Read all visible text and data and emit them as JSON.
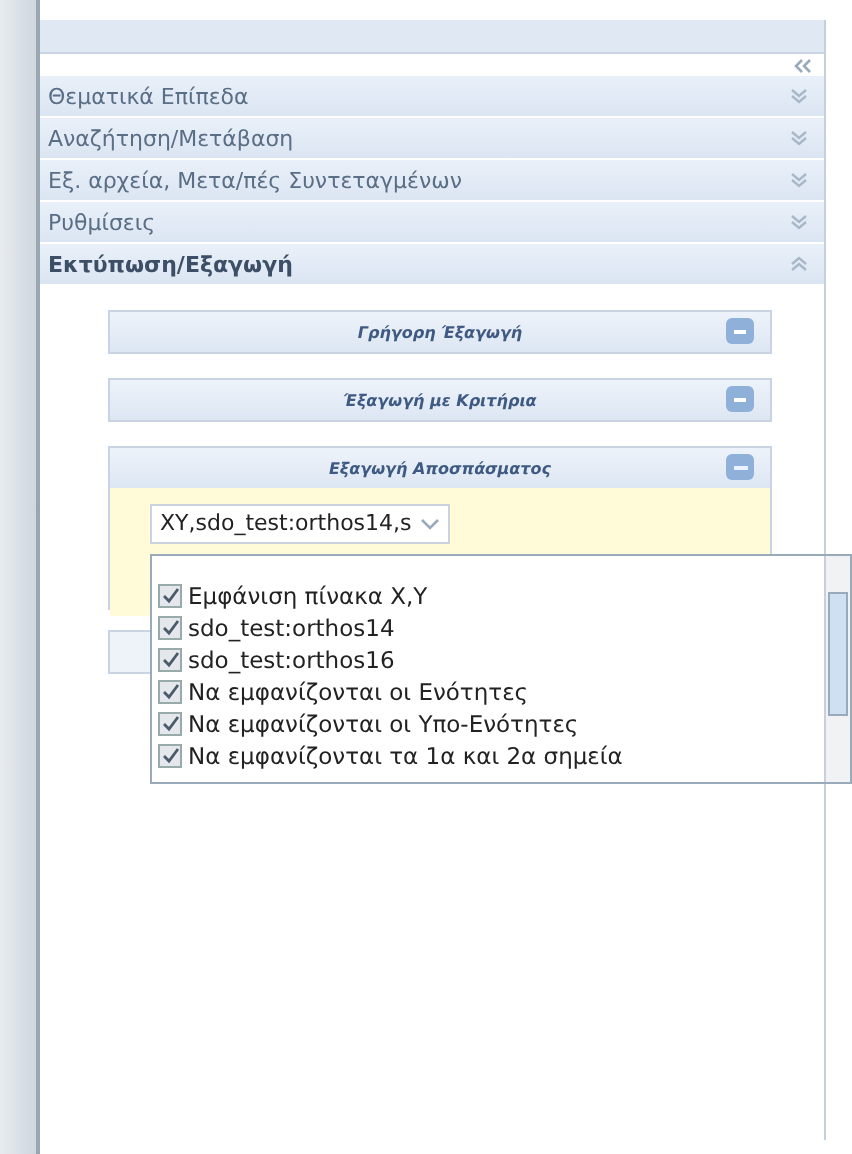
{
  "accordion": [
    {
      "label": "Θεματικά Επίπεδα",
      "expanded": false
    },
    {
      "label": "Αναζήτηση/Μετάβαση",
      "expanded": false
    },
    {
      "label": "Εξ. αρχεία, Μετα/πές Συντεταγμένων",
      "expanded": false
    },
    {
      "label": "Ρυθμίσεις",
      "expanded": false
    },
    {
      "label": "Εκτύπωση/Εξαγωγή",
      "expanded": true
    }
  ],
  "panels": [
    {
      "title": "Γρήγορη Έξαγωγή",
      "open": false
    },
    {
      "title": "Έξαγωγή με Κριτήρια",
      "open": false
    },
    {
      "title": "Εξαγωγή Αποσπάσματος",
      "open": true
    }
  ],
  "dropdown": {
    "value": "XY,sdo_test:orthos14,s"
  },
  "options": [
    {
      "label": "Εμφάνιση πίνακα X,Y",
      "checked": true
    },
    {
      "label": "sdo_test:orthos14",
      "checked": true
    },
    {
      "label": "sdo_test:orthos16",
      "checked": true
    },
    {
      "label": "Να εμφανίζονται οι Ενότητες",
      "checked": true
    },
    {
      "label": "Να εμφανίζονται οι Υπο-Ενότητες",
      "checked": true
    },
    {
      "label": "Να εμφανίζονται τα 1α και 2α σημεία",
      "checked": true
    }
  ]
}
